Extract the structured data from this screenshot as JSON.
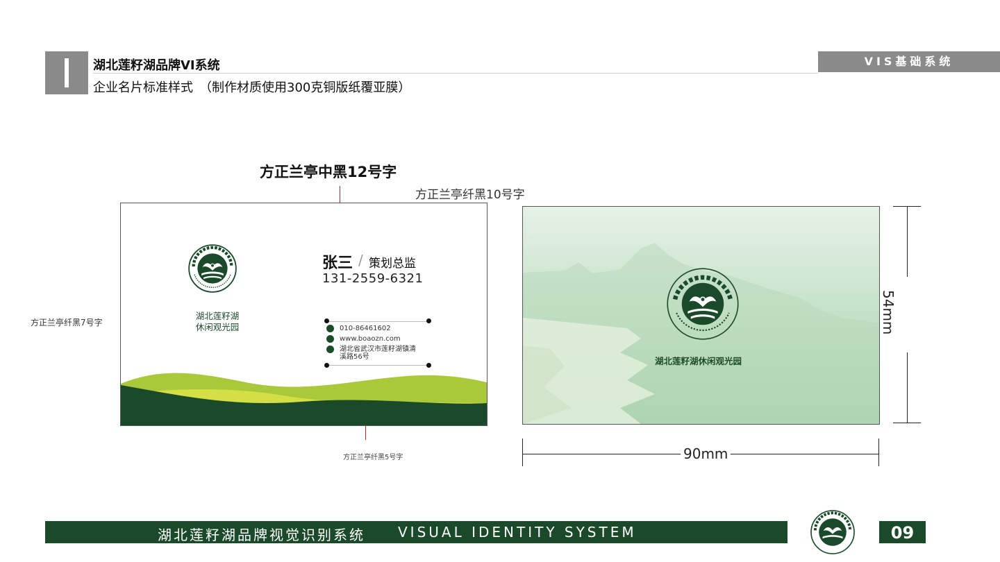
{
  "header": {
    "title": "湖北莲籽湖品牌VI系统",
    "subtitle": "企业名片标准样式　（制作材质使用300克铜版纸覆亚膜）",
    "section_tag": "VIS基础系统"
  },
  "annotations": {
    "font_name_label": "方正兰亭中黑12号字",
    "font_title_label": "方正兰亭纤黑10号字",
    "font_logo_label": "方正兰亭纤黑7号字",
    "font_contact_label": "方正兰亭纤黑5号字"
  },
  "card_front": {
    "name": "张三",
    "slash": "/",
    "job_title": "策划总监",
    "mobile": "131-2559-6321",
    "logo_caption_line1": "湖北莲籽湖",
    "logo_caption_line2": "休闲观光园",
    "contacts": {
      "phone": "010-86461602",
      "website": "www.boaozn.com",
      "address_line1": "湖北省武汉市莲籽湖镇清",
      "address_line2": "溪路56号"
    }
  },
  "logo": {
    "arc_text_cn": "莲籽湖休闲观光园",
    "arc_text_en": "ECOLOGICAL SIGHTSEEING GARDEN"
  },
  "card_back": {
    "caption": "湖北莲籽湖休闲观光园"
  },
  "dimensions": {
    "height_label": "54mm",
    "width_label": "90mm"
  },
  "footer": {
    "title_cn": "湖北莲籽湖品牌视觉识别系统",
    "title_en": "VISUAL IDENTITY SYSTEM",
    "page_number": "09"
  },
  "colors": {
    "brand_green": "#1b4a2a",
    "light_green": "#c8d83a",
    "accent_red": "#c0282a",
    "header_gray": "#8a8a8a"
  }
}
